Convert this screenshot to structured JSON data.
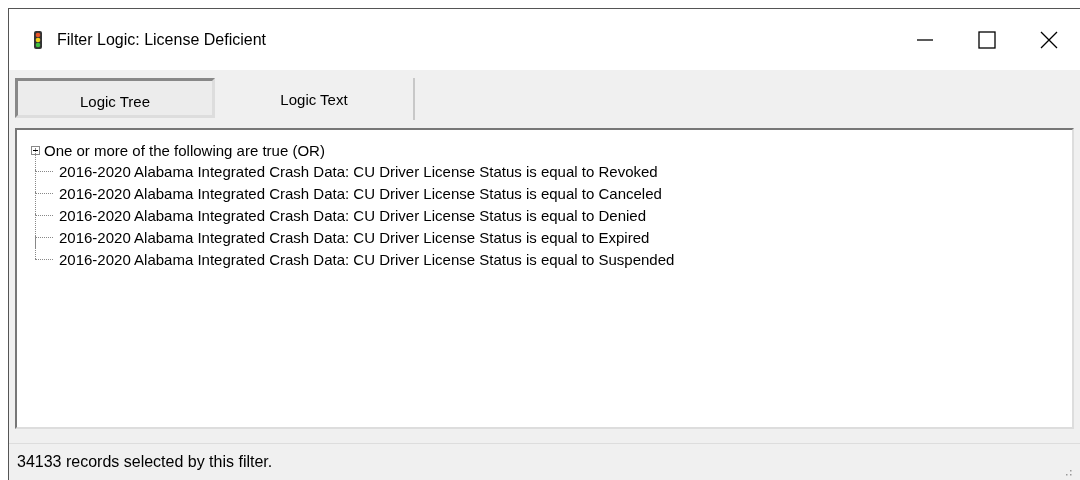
{
  "window": {
    "title": "Filter Logic: License Deficient"
  },
  "tabs": [
    {
      "label": "Logic Tree",
      "selected": true
    },
    {
      "label": "Logic Text",
      "selected": false
    }
  ],
  "tree": {
    "label": "One or more of the following are true (OR)",
    "expanded": true,
    "children": [
      {
        "label": "2016-2020 Alabama Integrated Crash Data: CU Driver License Status is equal to Revoked"
      },
      {
        "label": "2016-2020 Alabama Integrated Crash Data: CU Driver License Status is equal to Canceled"
      },
      {
        "label": "2016-2020 Alabama Integrated Crash Data: CU Driver License Status is equal to Denied"
      },
      {
        "label": "2016-2020 Alabama Integrated Crash Data: CU Driver License Status is equal to Expired"
      },
      {
        "label": "2016-2020 Alabama Integrated Crash Data: CU Driver License Status is equal to Suspended"
      }
    ]
  },
  "status_bar": "34133 records selected by this filter."
}
